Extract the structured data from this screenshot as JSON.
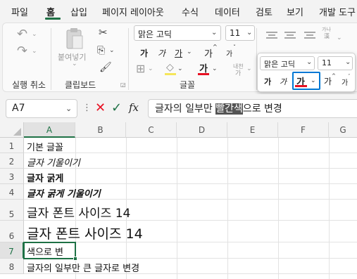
{
  "menu": {
    "tabs": [
      "파일",
      "홈",
      "삽입",
      "페이지 레이아웃",
      "수식",
      "데이터",
      "검토",
      "보기",
      "개발 도구"
    ],
    "active": "홈"
  },
  "ribbon": {
    "undo_group_label": "실행 취소",
    "clipboard": {
      "paste_label": "붙여넣기",
      "group_label": "클립보드"
    },
    "font": {
      "name": "맑은 고딕",
      "size": "11",
      "group_label": "글꼴",
      "bold_glyph": "가",
      "italic_glyph": "가",
      "underline_glyph": "가",
      "grow_glyph": "가",
      "shrink_glyph": "가",
      "font_color_glyph": "가",
      "phonetic_glyph": "내천",
      "phonetic_glyph2": "가",
      "hangul_hanja": "가나",
      "hangul_hanja2": "漢"
    },
    "accent_color": "#1e7145",
    "font_color": "#e81123"
  },
  "mini_toolbar": {
    "font_name": "맑은 고딕",
    "font_size": "11",
    "bold_glyph": "가",
    "italic_glyph": "가",
    "font_color_glyph": "가",
    "grow_glyph": "가",
    "shrink_glyph": "가",
    "highlight_color": "#0078d4"
  },
  "formula_bar": {
    "name_box": "A7",
    "fx": "fx",
    "text_before": "글자의 일부만 ",
    "text_selected": "빨간색",
    "text_after": "으로 변경"
  },
  "sheet": {
    "columns": [
      "A",
      "B",
      "C",
      "D",
      "E",
      "F",
      "G"
    ],
    "rows": [
      "1",
      "2",
      "3",
      "4",
      "5",
      "6",
      "7",
      "8"
    ],
    "cells": {
      "a1": "기본 글꼴",
      "a2": "글자 기울이기",
      "a3": "글자 굵게",
      "a4": "글자 굵게 기울이기",
      "a5": "글자 폰트 사이즈 14",
      "a6": "글자 폰트 사이즈 14",
      "a7": "색으로 변",
      "a8": "글자의 일부만 큰 글자로 변경"
    }
  }
}
